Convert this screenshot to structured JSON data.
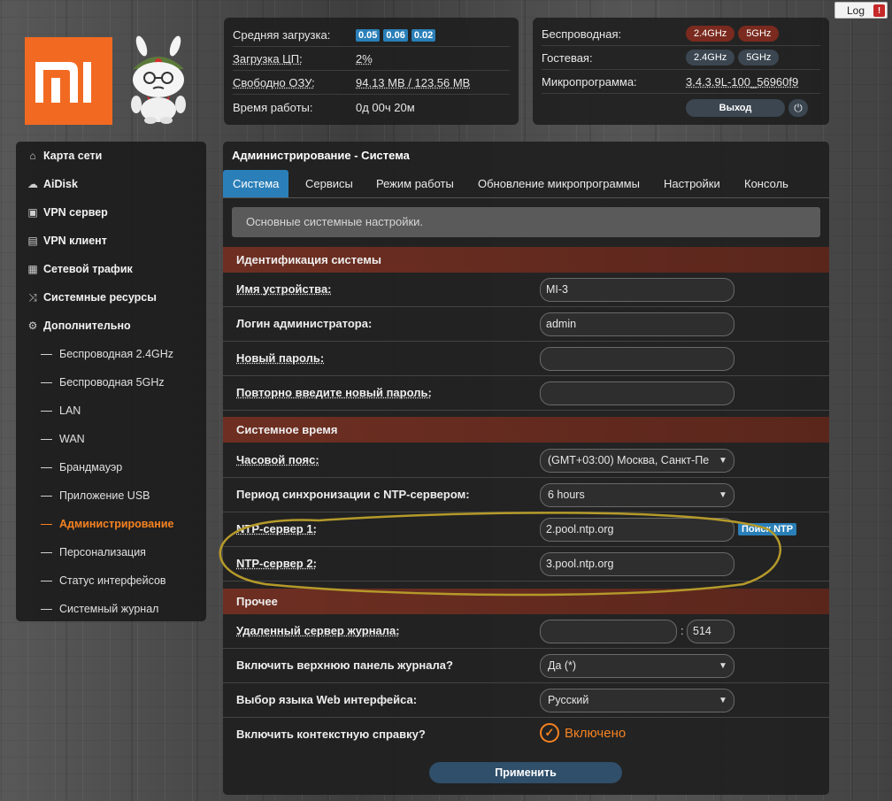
{
  "log_button": {
    "label": "Log",
    "badge": "!"
  },
  "brand": {
    "logo_text": "MI",
    "logo_color": "#f26a21"
  },
  "status_left": {
    "avg_load": {
      "label": "Средняя загрузка:",
      "values": [
        "0.05",
        "0.06",
        "0.02"
      ]
    },
    "cpu": {
      "label": "Загрузка ЦП:",
      "value": "2%"
    },
    "ram": {
      "label": "Свободно ОЗУ:",
      "value": "94.13 MB / 123.56 MB"
    },
    "uptime": {
      "label": "Время работы:",
      "value": "0д 00ч 20м"
    }
  },
  "status_right": {
    "wireless": {
      "label": "Беспроводная:",
      "badges": [
        "2.4GHz",
        "5GHz"
      ]
    },
    "guest": {
      "label": "Гостевая:",
      "badges": [
        "2.4GHz",
        "5GHz"
      ]
    },
    "firmware": {
      "label": "Микропрограмма:",
      "value": "3.4.3.9L-100_56960f9"
    },
    "exit_button": "Выход",
    "power_icon": "power-icon"
  },
  "sidebar": {
    "items": [
      {
        "label": "Карта сети",
        "icon": "home-icon"
      },
      {
        "label": "AiDisk",
        "icon": "cloud-icon"
      },
      {
        "label": "VPN сервер",
        "icon": "vpn-server-icon"
      },
      {
        "label": "VPN клиент",
        "icon": "vpn-client-icon"
      },
      {
        "label": "Сетевой трафик",
        "icon": "traffic-icon"
      },
      {
        "label": "Системные ресурсы",
        "icon": "shuffle-icon"
      },
      {
        "label": "Дополнительно",
        "icon": "gear-icon"
      }
    ],
    "subitems": [
      "Беспроводная 2.4GHz",
      "Беспроводная 5GHz",
      "LAN",
      "WAN",
      "Брандмауэр",
      "Приложение USB",
      "Администрирование",
      "Персонализация",
      "Статус интерфейсов",
      "Системный журнал"
    ],
    "active_subitem": "Администрирование"
  },
  "main": {
    "title": "Администрирование - Система",
    "tabs": [
      "Система",
      "Сервисы",
      "Режим работы",
      "Обновление микропрограммы",
      "Настройки",
      "Консоль"
    ],
    "active_tab": "Система",
    "info": "Основные системные настройки.",
    "sections": {
      "identification": "Идентификация системы",
      "time": "Системное время",
      "other": "Прочее"
    },
    "fields": {
      "device_name": {
        "label": "Имя устройства:",
        "value": "MI-3"
      },
      "admin_login": {
        "label": "Логин администратора:",
        "value": "admin"
      },
      "new_password": {
        "label": "Новый пароль:",
        "value": ""
      },
      "repeat_password": {
        "label": "Повторно введите новый пароль:",
        "value": ""
      },
      "timezone": {
        "label": "Часовой пояс:",
        "value": "(GMT+03:00) Москва, Санкт-Пе"
      },
      "ntp_period": {
        "label": "Период синхронизации с NTP-сервером:",
        "value": "6 hours"
      },
      "ntp1": {
        "label": "NTP-сервер 1:",
        "value": "2.pool.ntp.org",
        "button": "Поиск NTP"
      },
      "ntp2": {
        "label": "NTP-сервер 2:",
        "value": "3.pool.ntp.org"
      },
      "remote_log": {
        "label": "Удаленный сервер журнала:",
        "value": "",
        "separator": ":",
        "port": "514"
      },
      "log_top_panel": {
        "label": "Включить верхнюю панель журнала?",
        "value": "Да (*)"
      },
      "web_language": {
        "label": "Выбор языка Web интерфейса:",
        "value": "Русский"
      },
      "context_help": {
        "label": "Включить контекстную справку?",
        "value": "Включено"
      }
    },
    "apply_button": "Применить"
  },
  "colors": {
    "accent_orange": "#f58220",
    "accent_blue": "#2a7fb8",
    "section_red": "#6e2f22",
    "annotation": "#b59a2a"
  }
}
